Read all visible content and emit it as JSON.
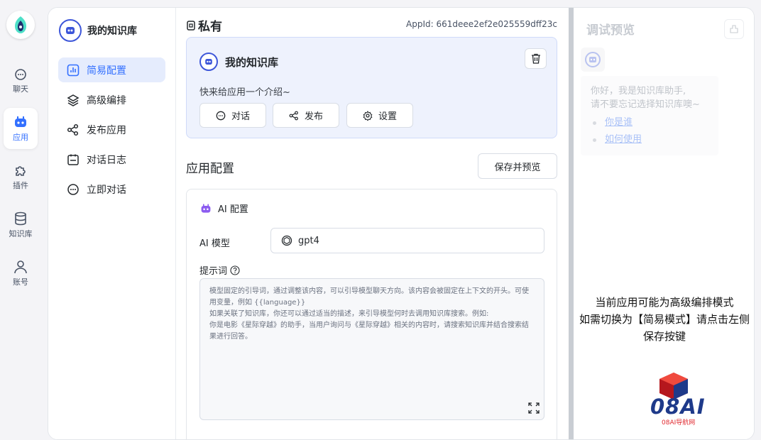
{
  "rail": {
    "items": [
      {
        "label": "聊天",
        "icon": "chat-icon"
      },
      {
        "label": "应用",
        "icon": "robot-icon"
      },
      {
        "label": "插件",
        "icon": "puzzle-icon"
      },
      {
        "label": "知识库",
        "icon": "database-icon"
      },
      {
        "label": "账号",
        "icon": "user-icon"
      }
    ],
    "active": "应用"
  },
  "sidebar": {
    "app_name": "我的知识库",
    "items": [
      {
        "label": "简易配置",
        "icon": "bar-chart-icon"
      },
      {
        "label": "高级编排",
        "icon": "layers-icon"
      },
      {
        "label": "发布应用",
        "icon": "share-icon"
      },
      {
        "label": "对话日志",
        "icon": "calendar-log-icon"
      },
      {
        "label": "立即对话",
        "icon": "chat-icon"
      }
    ]
  },
  "main": {
    "title": "私有",
    "appid": "AppId: 661deee2ef2e025559dff23c",
    "app_card": {
      "name": "我的知识库",
      "intro": "快来给应用一个介绍~",
      "buttons": {
        "chat": "对话",
        "publish": "发布",
        "settings": "设置"
      }
    },
    "section_title": "应用配置",
    "save_preview": "保存并预览",
    "ai_config": {
      "title": "AI 配置",
      "model_label": "AI 模型",
      "model_value": "gpt4",
      "prompt_label": "提示词",
      "prompt_placeholder": "模型固定的引导词，通过调整该内容，可以引导模型聊天方向。该内容会被固定在上下文的开头。可使用变量，例如 {{language}}\n如果关联了知识库，你还可以通过适当的描述，来引导模型何时去调用知识库搜索。例如:\n你是电影《星际穿越》的助手，当用户询问与《星际穿越》相关的内容时，请搜索知识库并结合搜索结果进行回答。"
    }
  },
  "debug": {
    "title": "调试预览",
    "welcome_line1": "你好，我是知识库助手,",
    "welcome_line2": "请不要忘记选择知识库噢~",
    "questions": [
      "你是谁",
      "如何使用"
    ],
    "notice": "当前应用可能为高级编排模式\n如需切换为【简易模式】请点击左侧保存按键"
  },
  "watermark": {
    "text": "08AI",
    "sub": "08AI导航网"
  },
  "colors": {
    "accent": "#3370ff",
    "active_bg": "#e5ecfd",
    "card_bg": "#eef2fd"
  }
}
